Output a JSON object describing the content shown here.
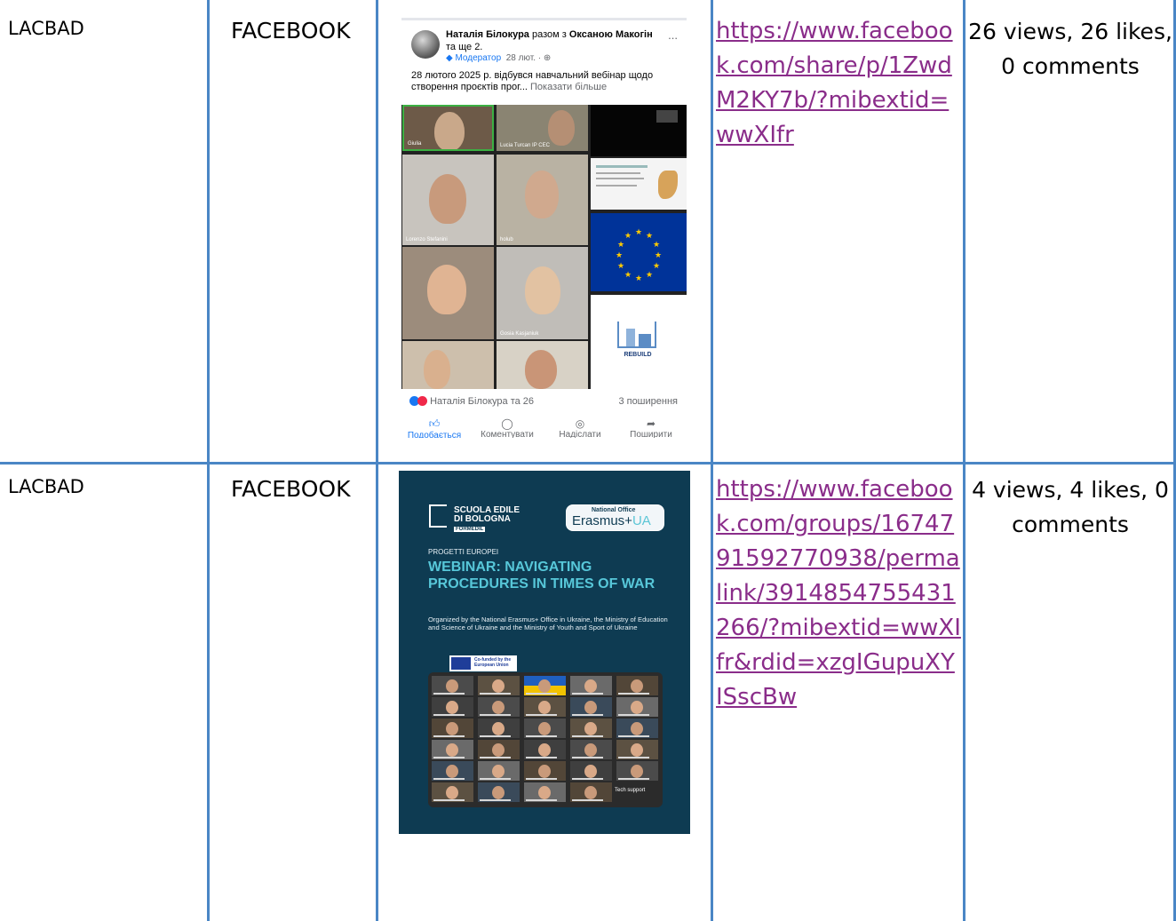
{
  "rows": [
    {
      "source": "LACBAD",
      "platform": "FACEBOOK",
      "link": "https://www.facebook.com/share/p/1ZwdM2KY7b/?mibextid=wwXIfr",
      "stats": "26 views, 26 likes, 0 comments",
      "post": {
        "author": "Наталія Білокура",
        "with_text": "разом з",
        "coauthor": "Оксаною Макогін",
        "others": "та ще 2.",
        "more_icon": "...",
        "role": "Модератор",
        "date": "28 лют. ·",
        "body": "28 лютого 2025 р. відбувся навчальний вебінар щодо створення проєктів прог...",
        "show_more": "Показати більше",
        "participants": [
          "Giulia",
          "Lucia Turcan IP CEC",
          "Lorenzo Stefanini",
          "holub",
          "Gosia Kasjaniuk"
        ],
        "slide_title": "REBUILD",
        "reactions": "Наталія Білокура та 26",
        "shares": "3 поширення",
        "actions": [
          "Подобається",
          "Коментувати",
          "Надіслати",
          "Поширити"
        ]
      }
    },
    {
      "source": "LACBAD",
      "platform": "FACEBOOK",
      "link": "https://www.facebook.com/groups/1674791592770938/permalink/3914854755431266/?mibextid=wwXIfr&rdid=xzgIGupuXYISscBw",
      "stats": "4 views, 4 likes, 0 comments",
      "poster": {
        "logo_left": "SCUOLA EDILE DI BOLOGNA",
        "logo_left_sub": "FORMEDIL",
        "logo_right_top": "National Office",
        "logo_right_main": "Erasmus+",
        "logo_right_ua": "UA",
        "tag": "PROGETTI EUROPEI",
        "title": "WEBINAR: NAVIGATING PROCEDURES IN TIMES OF WAR",
        "description": "Organized by the National Erasmus+ Office in Ukraine, the Ministry of Education and Science of Ukraine and the Ministry of Youth and Sport of Ukraine",
        "eu_badge": "Co-funded by the European Union",
        "tech_support": "Tech support"
      }
    }
  ],
  "colors": {
    "grid": "#4a86c5",
    "link": "#8a2d8a",
    "poster_bg": "#0e3b52",
    "poster_accent": "#57c7d9"
  }
}
